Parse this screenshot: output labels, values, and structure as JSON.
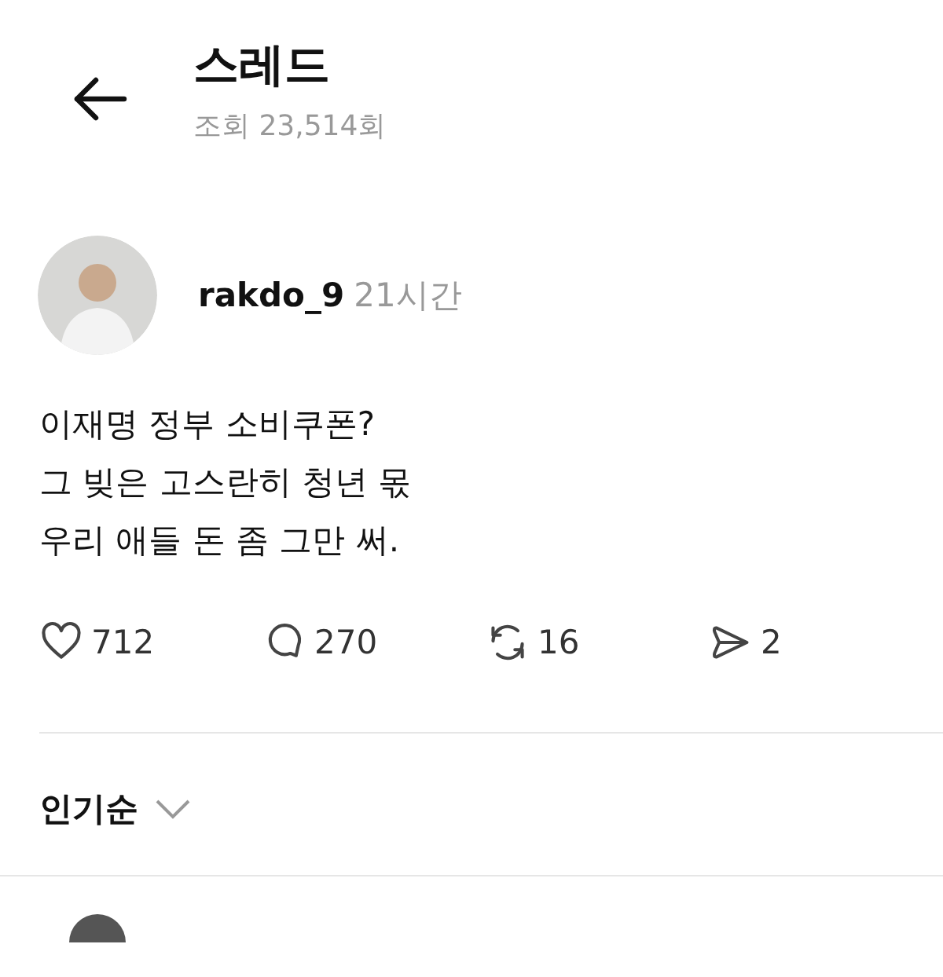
{
  "header": {
    "title": "스레드",
    "subtitle": "조회 23,514회"
  },
  "post": {
    "username": "rakdo_9",
    "time": "21시간",
    "lines": [
      "이재명 정부 소비쿠폰?",
      "그 빚은 고스란히 청년 몫",
      "우리 애들 돈 좀 그만 써."
    ],
    "actions": [
      {
        "kind": "like",
        "count": "712"
      },
      {
        "kind": "reply",
        "count": "270"
      },
      {
        "kind": "repost",
        "count": "16"
      },
      {
        "kind": "share",
        "count": "2"
      }
    ]
  },
  "sort": {
    "label": "인기순"
  }
}
